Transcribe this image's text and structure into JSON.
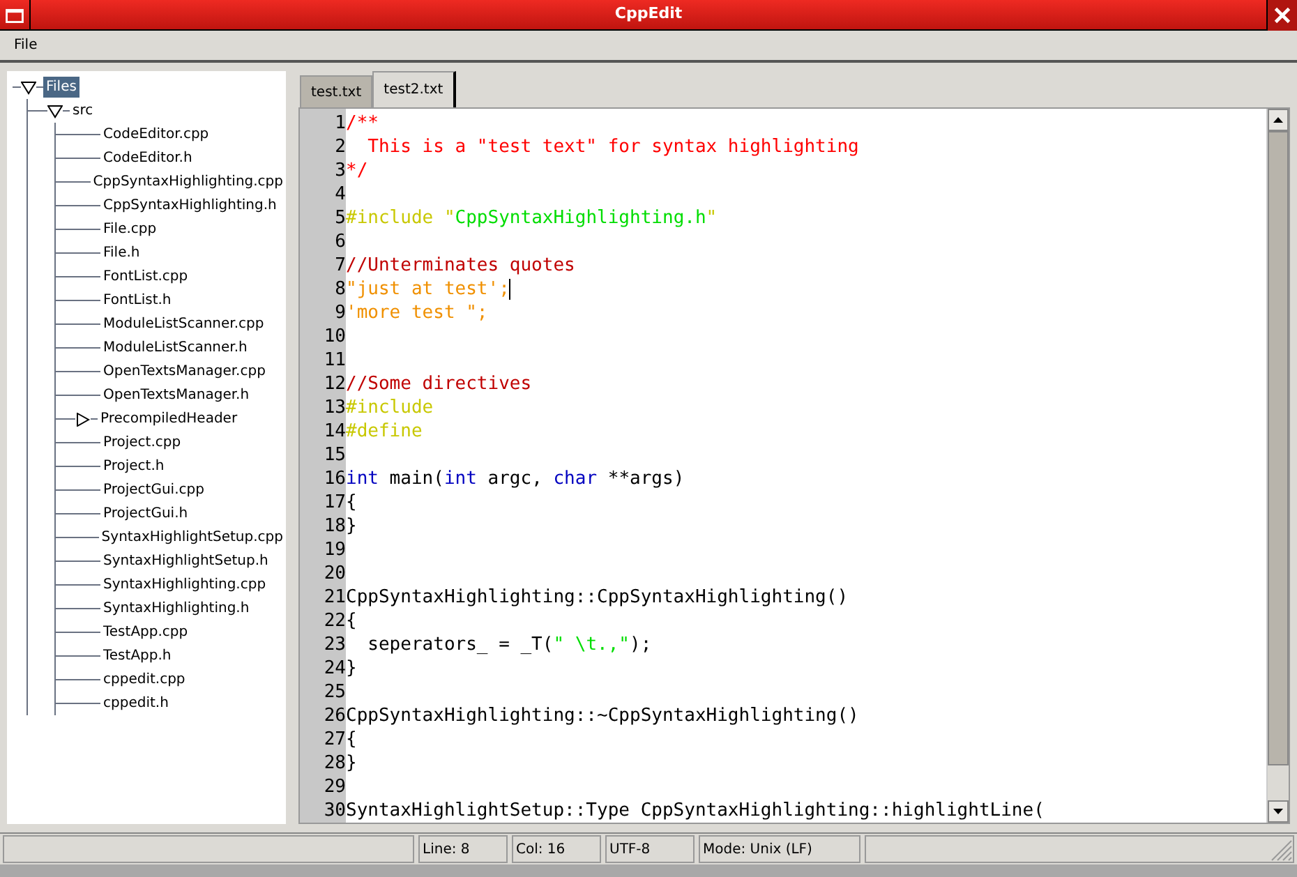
{
  "window": {
    "title": "CppEdit"
  },
  "menu": [
    {
      "label": "File"
    }
  ],
  "tree": {
    "label": "Files",
    "selected": true,
    "expanded": true,
    "children": [
      {
        "label": "src",
        "selected": false,
        "expanded": true,
        "children": [
          {
            "label": "CodeEditor.cpp",
            "selected": false
          },
          {
            "label": "CodeEditor.h",
            "selected": false
          },
          {
            "label": "CppSyntaxHighlighting.cpp",
            "selected": false
          },
          {
            "label": "CppSyntaxHighlighting.h",
            "selected": false
          },
          {
            "label": "File.cpp",
            "selected": false
          },
          {
            "label": "File.h",
            "selected": false
          },
          {
            "label": "FontList.cpp",
            "selected": false
          },
          {
            "label": "FontList.h",
            "selected": false
          },
          {
            "label": "ModuleListScanner.cpp",
            "selected": false
          },
          {
            "label": "ModuleListScanner.h",
            "selected": false
          },
          {
            "label": "OpenTextsManager.cpp",
            "selected": false
          },
          {
            "label": "OpenTextsManager.h",
            "selected": false
          },
          {
            "label": "PrecompiledHeader",
            "selected": false,
            "expanded": false
          },
          {
            "label": "Project.cpp",
            "selected": false
          },
          {
            "label": "Project.h",
            "selected": false
          },
          {
            "label": "ProjectGui.cpp",
            "selected": false
          },
          {
            "label": "ProjectGui.h",
            "selected": false
          },
          {
            "label": "SyntaxHighlightSetup.cpp",
            "selected": false
          },
          {
            "label": "SyntaxHighlightSetup.h",
            "selected": false
          },
          {
            "label": "SyntaxHighlighting.cpp",
            "selected": false
          },
          {
            "label": "SyntaxHighlighting.h",
            "selected": false
          },
          {
            "label": "TestApp.cpp",
            "selected": false
          },
          {
            "label": "TestApp.h",
            "selected": false
          },
          {
            "label": "cppedit.cpp",
            "selected": false
          },
          {
            "label": "cppedit.h",
            "selected": false
          }
        ]
      }
    ]
  },
  "tabs": [
    {
      "label": "test.txt",
      "selected": false
    },
    {
      "label": "test2.txt",
      "selected": true
    }
  ],
  "editor": {
    "lines": [
      {
        "number": "1",
        "caret": false,
        "segments": [
          {
            "kind": "doc_comment",
            "text": "/**"
          }
        ]
      },
      {
        "number": "2",
        "caret": false,
        "segments": [
          {
            "kind": "doc_comment",
            "text": "  This is a \"test text\" for syntax highlighting"
          }
        ]
      },
      {
        "number": "3",
        "caret": false,
        "segments": [
          {
            "kind": "doc_comment",
            "text": "*/"
          }
        ]
      },
      {
        "number": "4",
        "caret": false
      },
      {
        "number": "5",
        "caret": false,
        "segments": [
          {
            "kind": "preprocessor",
            "text": "#include \""
          },
          {
            "kind": "string",
            "text": "CppSyntaxHighlighting.h"
          },
          {
            "kind": "preprocessor",
            "text": "\""
          }
        ]
      },
      {
        "number": "6",
        "caret": false
      },
      {
        "number": "7",
        "caret": false,
        "segments": [
          {
            "kind": "comment",
            "text": "//Unterminates quotes"
          }
        ]
      },
      {
        "number": "8",
        "caret": true,
        "segments": [
          {
            "kind": "quote",
            "text": "\"just at test';"
          }
        ]
      },
      {
        "number": "9",
        "caret": false,
        "segments": [
          {
            "kind": "quote",
            "text": "'more test \";"
          }
        ]
      },
      {
        "number": "10",
        "caret": false
      },
      {
        "number": "11",
        "caret": false
      },
      {
        "number": "12",
        "caret": false,
        "segments": [
          {
            "kind": "comment",
            "text": "//Some directives"
          }
        ]
      },
      {
        "number": "13",
        "caret": false,
        "segments": [
          {
            "kind": "preprocessor",
            "text": "#include"
          }
        ]
      },
      {
        "number": "14",
        "caret": false,
        "segments": [
          {
            "kind": "preprocessor",
            "text": "#define"
          }
        ]
      },
      {
        "number": "15",
        "caret": false
      },
      {
        "number": "16",
        "caret": false,
        "segments": [
          {
            "kind": "keyword",
            "text": "int"
          },
          {
            "kind": "plain",
            "text": " main("
          },
          {
            "kind": "keyword",
            "text": "int"
          },
          {
            "kind": "plain",
            "text": " argc, "
          },
          {
            "kind": "keyword",
            "text": "char"
          },
          {
            "kind": "plain",
            "text": " **args)"
          }
        ]
      },
      {
        "number": "17",
        "caret": false,
        "segments": [
          {
            "kind": "plain",
            "text": "{"
          }
        ]
      },
      {
        "number": "18",
        "caret": false,
        "segments": [
          {
            "kind": "plain",
            "text": "}"
          }
        ]
      },
      {
        "number": "19",
        "caret": false
      },
      {
        "number": "20",
        "caret": false
      },
      {
        "number": "21",
        "caret": false,
        "segments": [
          {
            "kind": "plain",
            "text": "CppSyntaxHighlighting::CppSyntaxHighlighting()"
          }
        ]
      },
      {
        "number": "22",
        "caret": false,
        "segments": [
          {
            "kind": "plain",
            "text": "{"
          }
        ]
      },
      {
        "number": "23",
        "caret": false,
        "segments": [
          {
            "kind": "plain",
            "text": "  seperators_ = _T("
          },
          {
            "kind": "string",
            "text": "\" \\t.,\""
          },
          {
            "kind": "plain",
            "text": ");"
          }
        ]
      },
      {
        "number": "24",
        "caret": false,
        "segments": [
          {
            "kind": "plain",
            "text": "}"
          }
        ]
      },
      {
        "number": "25",
        "caret": false
      },
      {
        "number": "26",
        "caret": false,
        "segments": [
          {
            "kind": "plain",
            "text": "CppSyntaxHighlighting::~CppSyntaxHighlighting()"
          }
        ]
      },
      {
        "number": "27",
        "caret": false,
        "segments": [
          {
            "kind": "plain",
            "text": "{"
          }
        ]
      },
      {
        "number": "28",
        "caret": false,
        "segments": [
          {
            "kind": "plain",
            "text": "}"
          }
        ]
      },
      {
        "number": "29",
        "caret": false
      },
      {
        "number": "30",
        "caret": false,
        "segments": [
          {
            "kind": "plain",
            "text": "SyntaxHighlightSetup::Type CppSyntaxHighlighting::highlightLine("
          }
        ]
      }
    ]
  },
  "status_bar": {
    "line": "Line: 8",
    "column": "Col: 16",
    "encoding": "UTF-8",
    "mode": "Mode: Unix (LF)"
  }
}
